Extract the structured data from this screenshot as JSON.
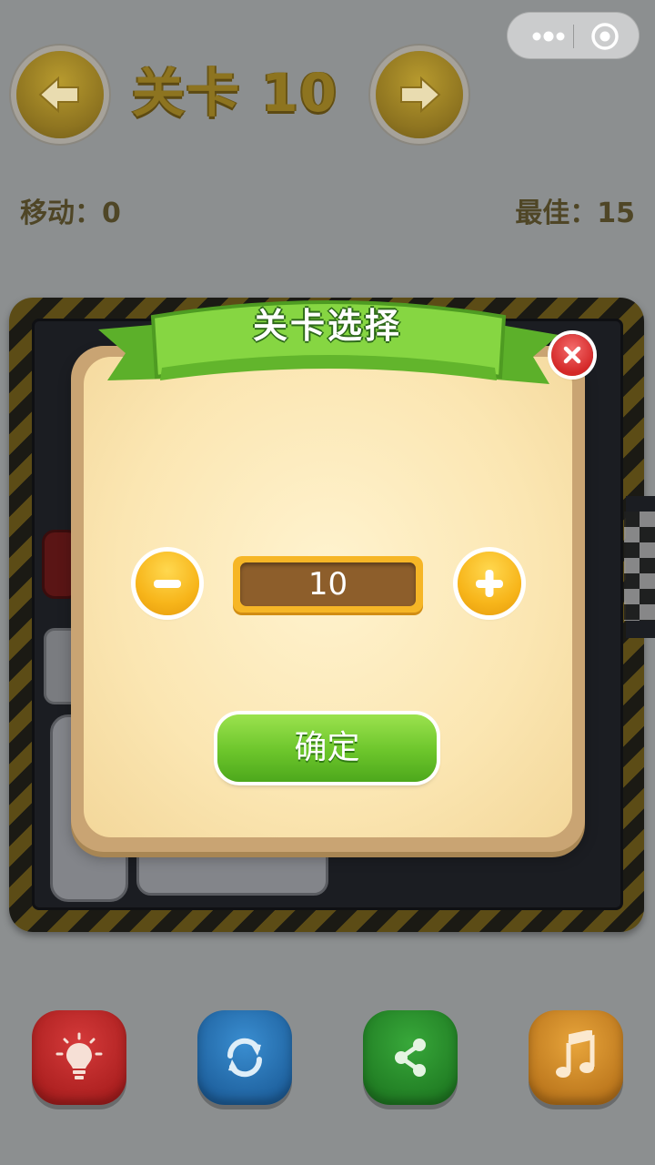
{
  "header": {
    "level_title": "关卡 10"
  },
  "stats": {
    "moves_label": "移动：0",
    "best_label": "最佳：15"
  },
  "dialog": {
    "title": "关卡选择",
    "level_value": "10",
    "confirm_label": "确定"
  },
  "icons": {
    "capsule": [
      "more-dots-icon",
      "target-icon"
    ],
    "nav": [
      "arrow-left-icon",
      "arrow-right-icon"
    ],
    "dialog": [
      "close-icon",
      "minus-icon",
      "plus-icon"
    ],
    "tools": [
      "lightbulb-icon",
      "refresh-icon",
      "share-icon",
      "music-note-icon"
    ]
  },
  "colors": {
    "board_stripe": "#5c4c16",
    "dialog_parchment": "#fbe6b2",
    "ribbon_green": "#7cd33c",
    "confirm_green": "#6cc52b",
    "stepper_orange": "#f7b51a",
    "close_red": "#d42828"
  }
}
